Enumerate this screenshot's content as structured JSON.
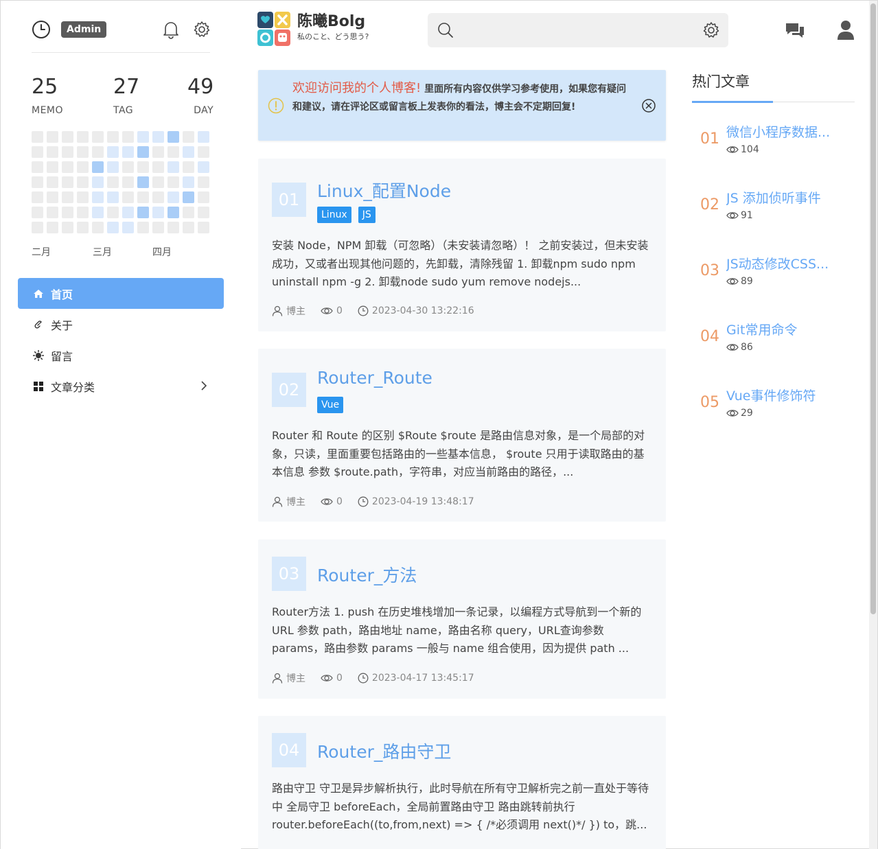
{
  "sidebar": {
    "admin_label": "Admin",
    "stats": [
      {
        "num": "25",
        "label": "MEMO"
      },
      {
        "num": "27",
        "label": "TAG"
      },
      {
        "num": "49",
        "label": "DAY"
      }
    ],
    "heatmap_levels": [
      [
        0,
        0,
        0,
        0,
        0,
        0,
        0,
        1,
        1,
        2,
        0,
        1
      ],
      [
        0,
        0,
        0,
        0,
        0,
        1,
        1,
        2,
        0,
        0,
        1,
        0
      ],
      [
        0,
        0,
        0,
        0,
        2,
        1,
        0,
        0,
        0,
        1,
        0,
        1
      ],
      [
        0,
        0,
        0,
        0,
        1,
        0,
        0,
        2,
        0,
        0,
        1,
        0
      ],
      [
        0,
        0,
        0,
        0,
        1,
        1,
        0,
        0,
        0,
        1,
        2,
        0
      ],
      [
        0,
        0,
        0,
        0,
        1,
        0,
        1,
        2,
        1,
        2,
        0,
        0
      ],
      [
        0,
        0,
        0,
        0,
        0,
        1,
        1,
        0,
        0,
        0,
        0,
        0
      ]
    ],
    "months": [
      "二月",
      "三月",
      "四月"
    ],
    "nav": [
      {
        "label": "首页",
        "icon": "home-icon"
      },
      {
        "label": "关于",
        "icon": "link-icon"
      },
      {
        "label": "留言",
        "icon": "sun-icon"
      },
      {
        "label": "文章分类",
        "icon": "grid-icon"
      }
    ]
  },
  "header": {
    "brand_name": "陈曦Bolg",
    "brand_tagline": "私のこと、どう思う?",
    "search_placeholder": ""
  },
  "notice": {
    "highlight": "欢迎访问我的个人博客!",
    "text": "里面所有内容仅供学习参考使用，如果您有疑问和建议，请在评论区或留言板上发表你的看法，博主会不定期回复!"
  },
  "articles": [
    {
      "index": "01",
      "title": "Linux_配置Node",
      "tags": [
        "Linux",
        "JS"
      ],
      "excerpt": "安装 Node，NPM 卸载（可忽略）（未安装请忽略）！ 之前安装过，但未安装成功，又或者出现其他问题的，先卸载，清除残留 1. 卸载npm sudo npm uninstall npm -g 2. 卸载node sudo yum remove nodejs...",
      "author": "博主",
      "views": "0",
      "date": "2023-04-30 13:22:16"
    },
    {
      "index": "02",
      "title": "Router_Route",
      "tags": [
        "Vue"
      ],
      "excerpt": "Router 和 Route 的区别 $Route $route 是路由信息对象，是一个局部的对象，只读，里面重要包括路由的一些基本信息， $route 只用于读取路由的基本信息 参数 $route.path，字符串，对应当前路由的路径，...",
      "author": "博主",
      "views": "0",
      "date": "2023-04-19 13:48:17"
    },
    {
      "index": "03",
      "title": "Router_方法",
      "tags": [],
      "excerpt": "Router方法 1. push 在历史堆栈增加一条记录，以编程方式导航到一个新的URL 参数 path，路由地址 name，路由名称 query，URL查询参数 params，路由参数 params 一般与 name 组合使用，因为提供 path ...",
      "author": "博主",
      "views": "0",
      "date": "2023-04-17 13:45:17"
    },
    {
      "index": "04",
      "title": "Router_路由守卫",
      "tags": [],
      "excerpt": "路由守卫 守卫是异步解析执行，此时导航在所有守卫解析完之前一直处于等待中 全局守卫 beforeEach，全局前置路由守卫 路由跳转前执行 router.beforeEach((to,from,next) => { /*必须调用 next()*/ }) to，跳...",
      "author": "",
      "views": "",
      "date": ""
    }
  ],
  "hot": {
    "title": "热门文章",
    "items": [
      {
        "num": "01",
        "title": "微信小程序数据...",
        "views": "104"
      },
      {
        "num": "02",
        "title": "JS 添加侦听事件",
        "views": "91"
      },
      {
        "num": "03",
        "title": "JS动态修改CSS...",
        "views": "89"
      },
      {
        "num": "04",
        "title": "Git常用命令",
        "views": "86"
      },
      {
        "num": "05",
        "title": "Vue事件修饰符",
        "views": "29"
      }
    ]
  },
  "colors": {
    "accent": "#66a8f5",
    "tag": "#2a95ef",
    "hot_number": "#ec9a66",
    "notice_bg": "#d4e7fa",
    "notice_highlight": "#e25b47"
  }
}
